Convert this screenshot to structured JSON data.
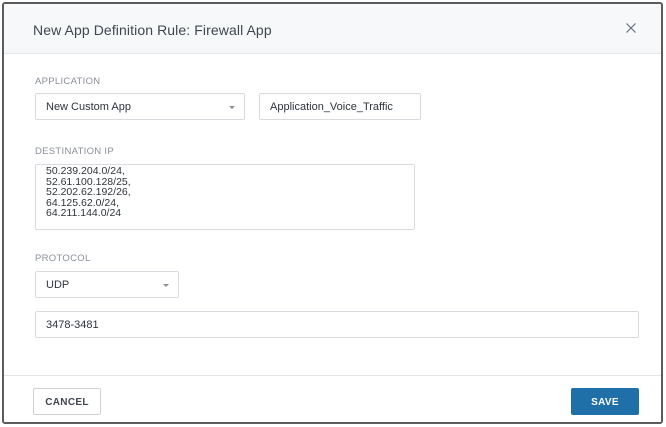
{
  "dialog": {
    "title": "New App Definition Rule: Firewall App"
  },
  "application": {
    "label": "APPLICATION",
    "app_select_value": "New Custom App",
    "app_name_value": "Application_Voice_Traffic"
  },
  "destination_ip": {
    "label": "DESTINATION IP",
    "lines": [
      "50.239.204.0/24,",
      "52.61.100.128/25,",
      "52.202.62.192/26,",
      "64.125.62.0/24,",
      "64.211.144.0/24"
    ]
  },
  "protocol": {
    "label": "PROTOCOL",
    "select_value": "UDP",
    "port_value": "3478-3481"
  },
  "footer": {
    "cancel_label": "CANCEL",
    "save_label": "SAVE"
  },
  "colors": {
    "primary": "#1f6fa8",
    "header_bg": "#f7f8f9",
    "label_text": "#8a9099"
  }
}
